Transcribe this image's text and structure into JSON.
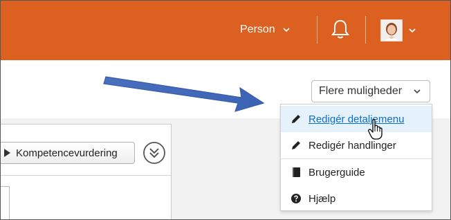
{
  "header": {
    "person_menu_label": "Person",
    "accent_color": "#dc6121"
  },
  "toolbar": {
    "more_options_label": "Flere muligheder"
  },
  "dropdown": {
    "items": [
      {
        "label": "Redigér detaljemenu",
        "icon": "pencil-icon",
        "highlighted": true
      },
      {
        "label": "Redigér handlinger",
        "icon": "pencil-icon"
      },
      {
        "label": "Brugerguide",
        "icon": "book-icon"
      },
      {
        "label": "Hjælp",
        "icon": "help-circle-icon"
      }
    ]
  },
  "content": {
    "competence_button_label": "Kompetencevurdering"
  },
  "icons": {
    "notifications": "bell-icon",
    "expand": "double-chevron-down-icon",
    "annotation": "annotation-arrow",
    "pointer": "hand-pointer-icon"
  }
}
